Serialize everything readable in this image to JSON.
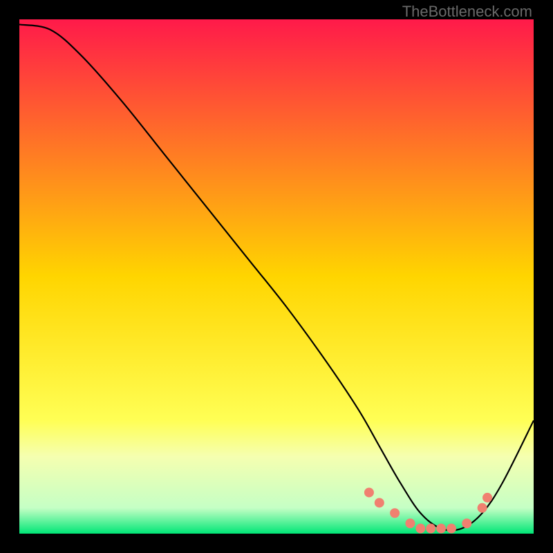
{
  "attribution": "TheBottleneck.com",
  "chart_data": {
    "type": "line",
    "title": "",
    "xlabel": "",
    "ylabel": "",
    "xlim": [
      0,
      100
    ],
    "ylim": [
      0,
      100
    ],
    "background_gradient": [
      {
        "stop": 0,
        "color": "#ff1a4a"
      },
      {
        "stop": 50,
        "color": "#ffd500"
      },
      {
        "stop": 78,
        "color": "#ffff55"
      },
      {
        "stop": 85,
        "color": "#f5ffb0"
      },
      {
        "stop": 95,
        "color": "#c5ffc5"
      },
      {
        "stop": 100,
        "color": "#00e676"
      }
    ],
    "series": [
      {
        "name": "bottleneck-curve",
        "x": [
          0,
          6,
          12,
          20,
          28,
          36,
          44,
          52,
          60,
          66,
          70,
          74,
          78,
          82,
          86,
          90,
          94,
          100
        ],
        "values": [
          99,
          98,
          93,
          84,
          74,
          64,
          54,
          44,
          33,
          24,
          17,
          10,
          4,
          1,
          1,
          4,
          10,
          22
        ]
      }
    ],
    "markers": {
      "name": "highlight-points",
      "x": [
        68,
        70,
        73,
        76,
        78,
        80,
        82,
        84,
        87,
        90,
        91
      ],
      "values": [
        8,
        6,
        4,
        2,
        1,
        1,
        1,
        1,
        2,
        5,
        7
      ],
      "color": "#f08070",
      "radius": 7
    }
  }
}
